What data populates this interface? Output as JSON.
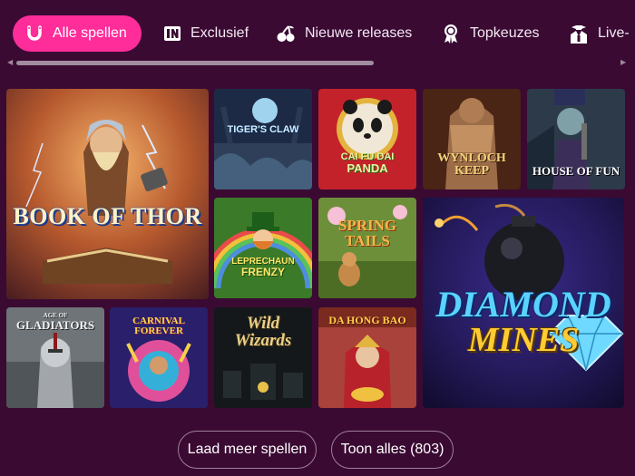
{
  "tabs": [
    {
      "label": "Alle spellen",
      "icon": "horseshoe-icon",
      "active": true
    },
    {
      "label": "Exclusief",
      "icon": "in-badge-icon",
      "active": false
    },
    {
      "label": "Nieuwe releases",
      "icon": "cherries-icon",
      "active": false
    },
    {
      "label": "Topkeuzes",
      "icon": "award-ribbon-icon",
      "active": false
    },
    {
      "label": "Live-",
      "icon": "dealer-icon",
      "active": false
    }
  ],
  "games": [
    {
      "id": "book-of-thor",
      "title": "BOOK OF THOR"
    },
    {
      "id": "tigers-claw",
      "title": "TIGER'S CLAW"
    },
    {
      "id": "cai-fu-dai-panda",
      "title_line1": "CAI FU DAI",
      "title_line2": "PANDA"
    },
    {
      "id": "wynloch-keep",
      "title_line1": "WYNLOCH",
      "title_line2": "KEEP"
    },
    {
      "id": "house-of-fun",
      "title": "HOUSE OF FUN"
    },
    {
      "id": "leprechaun-frenzy",
      "title_line1": "LEPRECHAUN",
      "title_line2": "FRENZY"
    },
    {
      "id": "spring-tails",
      "title_line1": "SPRING",
      "title_line2": "TAILS"
    },
    {
      "id": "diamond-mines",
      "title_line1": "DIAMOND",
      "title_line2": "MINES"
    },
    {
      "id": "age-of-gladiators",
      "title_small": "AGE OF",
      "title": "GLADIATORS"
    },
    {
      "id": "carnival-forever",
      "title_line1": "CARNIVAL",
      "title_line2": "FOREVER"
    },
    {
      "id": "wild-wizards",
      "title_line1": "Wild",
      "title_line2": "Wizards"
    },
    {
      "id": "da-hong-bao",
      "title": "DA HONG BAO"
    }
  ],
  "buttons": {
    "load_more": "Laad meer spellen",
    "show_all": "Toon alles (803)"
  },
  "colors": {
    "background": "#3a0a33",
    "accent": "#ff2d9a"
  }
}
